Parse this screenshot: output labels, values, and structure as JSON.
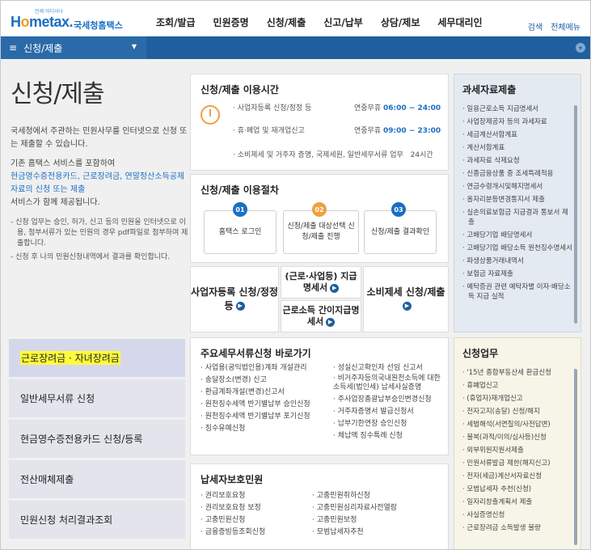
{
  "header": {
    "logo_sub": "언제 어디서나",
    "logo_main_a": "H",
    "logo_main_o": "o",
    "logo_main_b": "metax.",
    "logo_kor": "국세청홈택스",
    "gnb": [
      "조회/발급",
      "민원증명",
      "신청/제출",
      "신고/납부",
      "상담/제보",
      "세무대리인"
    ],
    "util": [
      "검색",
      "전체메뉴"
    ]
  },
  "navbar": {
    "current": "신청/제출"
  },
  "intro": {
    "title": "신청/제출",
    "p1": "국세청에서 주관하는 민원사무를 인터넷으로 신청 또는 제출할 수 있습니다.",
    "p2a": "기존 홈택스 서비스를 포함하여",
    "p2b": "현금영수증전용카드, 근로장려금, 연말정산소득공제자료의 신청 또는 제출",
    "p2c": "서비스가 함께 제공됩니다.",
    "notes": [
      "신청 업무는 승인, 허가, 신고 등의 민원을 인터넷으로 이용, 첨부서류가 있는 민원의 경우 pdf파일로 첨부하여 제출합니다.",
      "신청 후 나의 민원신청내역에서 결과를 확인합니다."
    ]
  },
  "left_menu": [
    "근로장려금 · 자녀장려금",
    "일반세무서류 신청",
    "현금영수증전용카드 신청/등록",
    "전산매체제출",
    "민원신청 처리결과조회"
  ],
  "time_card": {
    "title": "신청/제출 이용시간",
    "rows": [
      {
        "label": "· 사업자등록 신청/정정 등",
        "days": "연중무휴",
        "hours": "06:00 ~ 24:00"
      },
      {
        "label": "· 휴·폐업 및 재개업신고",
        "days": "연중무휴",
        "hours": "09:00 ~ 23:00"
      },
      {
        "label": "· 소비제세 및 거주자 증명, 국제세원, 일반세무서류 업무",
        "days": "",
        "hours": "24시간"
      }
    ]
  },
  "proc_card": {
    "title": "신청/제출 이용절차",
    "steps": [
      {
        "num": "01",
        "label": "홈택스 로그인"
      },
      {
        "num": "02",
        "label": "신청/제출 대상선택 신청/제출 진행"
      },
      {
        "num": "03",
        "label": "신청/제출 결과확인"
      }
    ]
  },
  "quick": {
    "biz": "사업자등록 신청/정정 등",
    "w1": "(근로·사업등) 지급명세서",
    "w2": "근로소득 간이지급명세서",
    "cons": "소비제세 신청/제출"
  },
  "major": {
    "title": "주요세무서류신청 바로가기",
    "left": [
      "· 사업용(공익법인용)계좌 개설관리",
      "· 송달장소(변경) 신고",
      "· 환급계좌개설(변경)신고서",
      "· 원천징수세액 반기별납부 승인신청",
      "· 원천징수세액 반기별납부 포기신청",
      "· 징수유예신청"
    ],
    "right": [
      "· 성실신고확인자 선임 신고서",
      "· 비거주자등의국내원천소득에 대한 소득세(법인세) 납세사실증명",
      "· 주사업장총괄납부승인변경신청",
      "· 거주자증명서 발급신청서",
      "· 납부기한연장 승인신청",
      "· 체납액 징수특례 신청"
    ]
  },
  "protect": {
    "title": "납세자보호민원",
    "left": [
      "· 권리보호요청",
      "· 권리보호요청 보정",
      "· 고충민원신청",
      "· 금융증빙등조회신청"
    ],
    "right": [
      "· 고충민원취하신청",
      "· 고충민원심리자료사전열람",
      "· 고충민원보정",
      "· 모범납세자추천"
    ]
  },
  "tax_panel": {
    "title": "과세자료제출",
    "items": [
      "· 일용근로소득 지급명세서",
      "· 사업장제공자 등의 과세자료",
      "· 세금계산서합계표",
      "· 계산서합계표",
      "· 과세자료 삭제요청",
      "· 신종금융상품 중 조세특례적용",
      "· 연금수령개시및해지명세서",
      "· 올자리분등변경통지서 제출",
      "· 실손의료보험금 지급결과 통보서 제출",
      "· 고배당기업 배당명세서",
      "· 고배당기업 배당소득 원천징수명세서",
      "· 파생상품거래내역서",
      "· 보험금 자료제출",
      "· 예탁증권 관련 예탁자별 이자·배당소득 지급 실적"
    ]
  },
  "apply_panel": {
    "title": "신청업무",
    "items": [
      "· '15년 종합부동산세 환급신청",
      "· 휴폐업신고",
      "· (휴업자)재개업신고",
      "· 전자고지(송달) 신청/해지",
      "· 세법해석(서면질의/사전답변)",
      "· 불복(과적/이의/심사등)신청",
      "· 외부위원지원서제출",
      "· 민원서류발급 제한(해지신고)",
      "· 전자(세금)계산서자료신청",
      "· 모범납세자 추천(신청)",
      "· 일자리창출계획서 제출",
      "· 사실증명신청",
      "· 근로장려금 소득발생 불량"
    ]
  }
}
